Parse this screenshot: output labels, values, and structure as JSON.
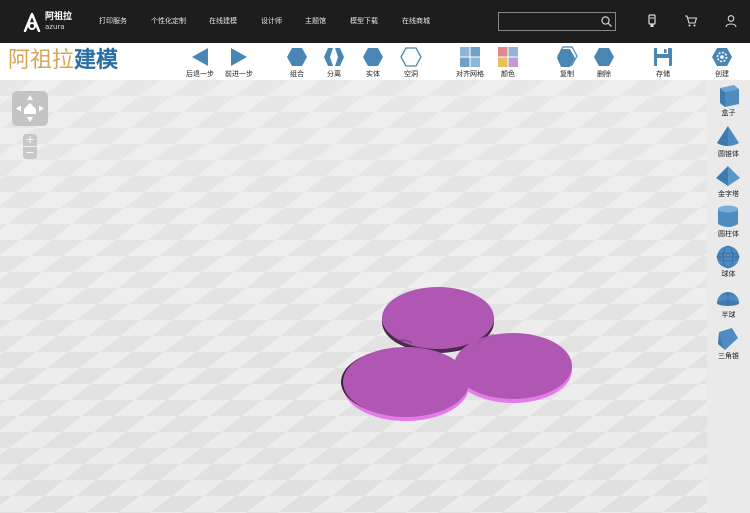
{
  "brand": {
    "name_cn": "阿祖拉",
    "name_en": "azura"
  },
  "nav": {
    "items": [
      {
        "label": "打印服务"
      },
      {
        "label": "个性化定制"
      },
      {
        "label": "在线建模"
      },
      {
        "label": "设计师"
      },
      {
        "label": "主题馆"
      },
      {
        "label": "模型下载"
      },
      {
        "label": "在线商城"
      }
    ],
    "search": {
      "value": "",
      "placeholder": ""
    },
    "icons": [
      "search-icon",
      "usb-icon",
      "cart-icon",
      "user-icon"
    ]
  },
  "app": {
    "title_part1": "阿祖拉",
    "title_part2": "建模"
  },
  "toolbar": {
    "tools": [
      {
        "label": "后退一步",
        "icon": "undo-arrow-icon"
      },
      {
        "label": "前进一步",
        "icon": "redo-arrow-icon"
      },
      {
        "label": "组合",
        "icon": "group-hexagon-icon"
      },
      {
        "label": "分离",
        "icon": "ungroup-hexagon-icon"
      },
      {
        "label": "实体",
        "icon": "solid-hexagon-icon"
      },
      {
        "label": "空洞",
        "icon": "hole-hexagon-icon"
      },
      {
        "label": "对齐网格",
        "icon": "align-grid-icon"
      },
      {
        "label": "颜色",
        "icon": "color-palette-icon"
      },
      {
        "label": "复制",
        "icon": "copy-hexagon-icon"
      },
      {
        "label": "删除",
        "icon": "delete-hexagon-icon"
      },
      {
        "label": "存储",
        "icon": "save-disk-icon"
      },
      {
        "label": "创建",
        "icon": "create-gear-icon"
      }
    ]
  },
  "view_controls": {
    "zoom_in": "+",
    "zoom_out": "−"
  },
  "shapes": [
    {
      "label": "盒子",
      "icon": "box-icon"
    },
    {
      "label": "圆锥体",
      "icon": "cone-icon"
    },
    {
      "label": "金字塔",
      "icon": "pyramid-icon"
    },
    {
      "label": "圆柱体",
      "icon": "cylinder-icon"
    },
    {
      "label": "球体",
      "icon": "sphere-icon"
    },
    {
      "label": "半球",
      "icon": "hemisphere-icon"
    },
    {
      "label": "三角锥",
      "icon": "triangular-pyramid-icon"
    }
  ],
  "colors": {
    "nav_bg": "#1d1d1d",
    "accent_blue": "#4a86b4",
    "brand_gold": "#d4a656",
    "brand_blue": "#2a6ea8",
    "model_purple": "#b057b4",
    "model_edge": "#e37bea"
  }
}
